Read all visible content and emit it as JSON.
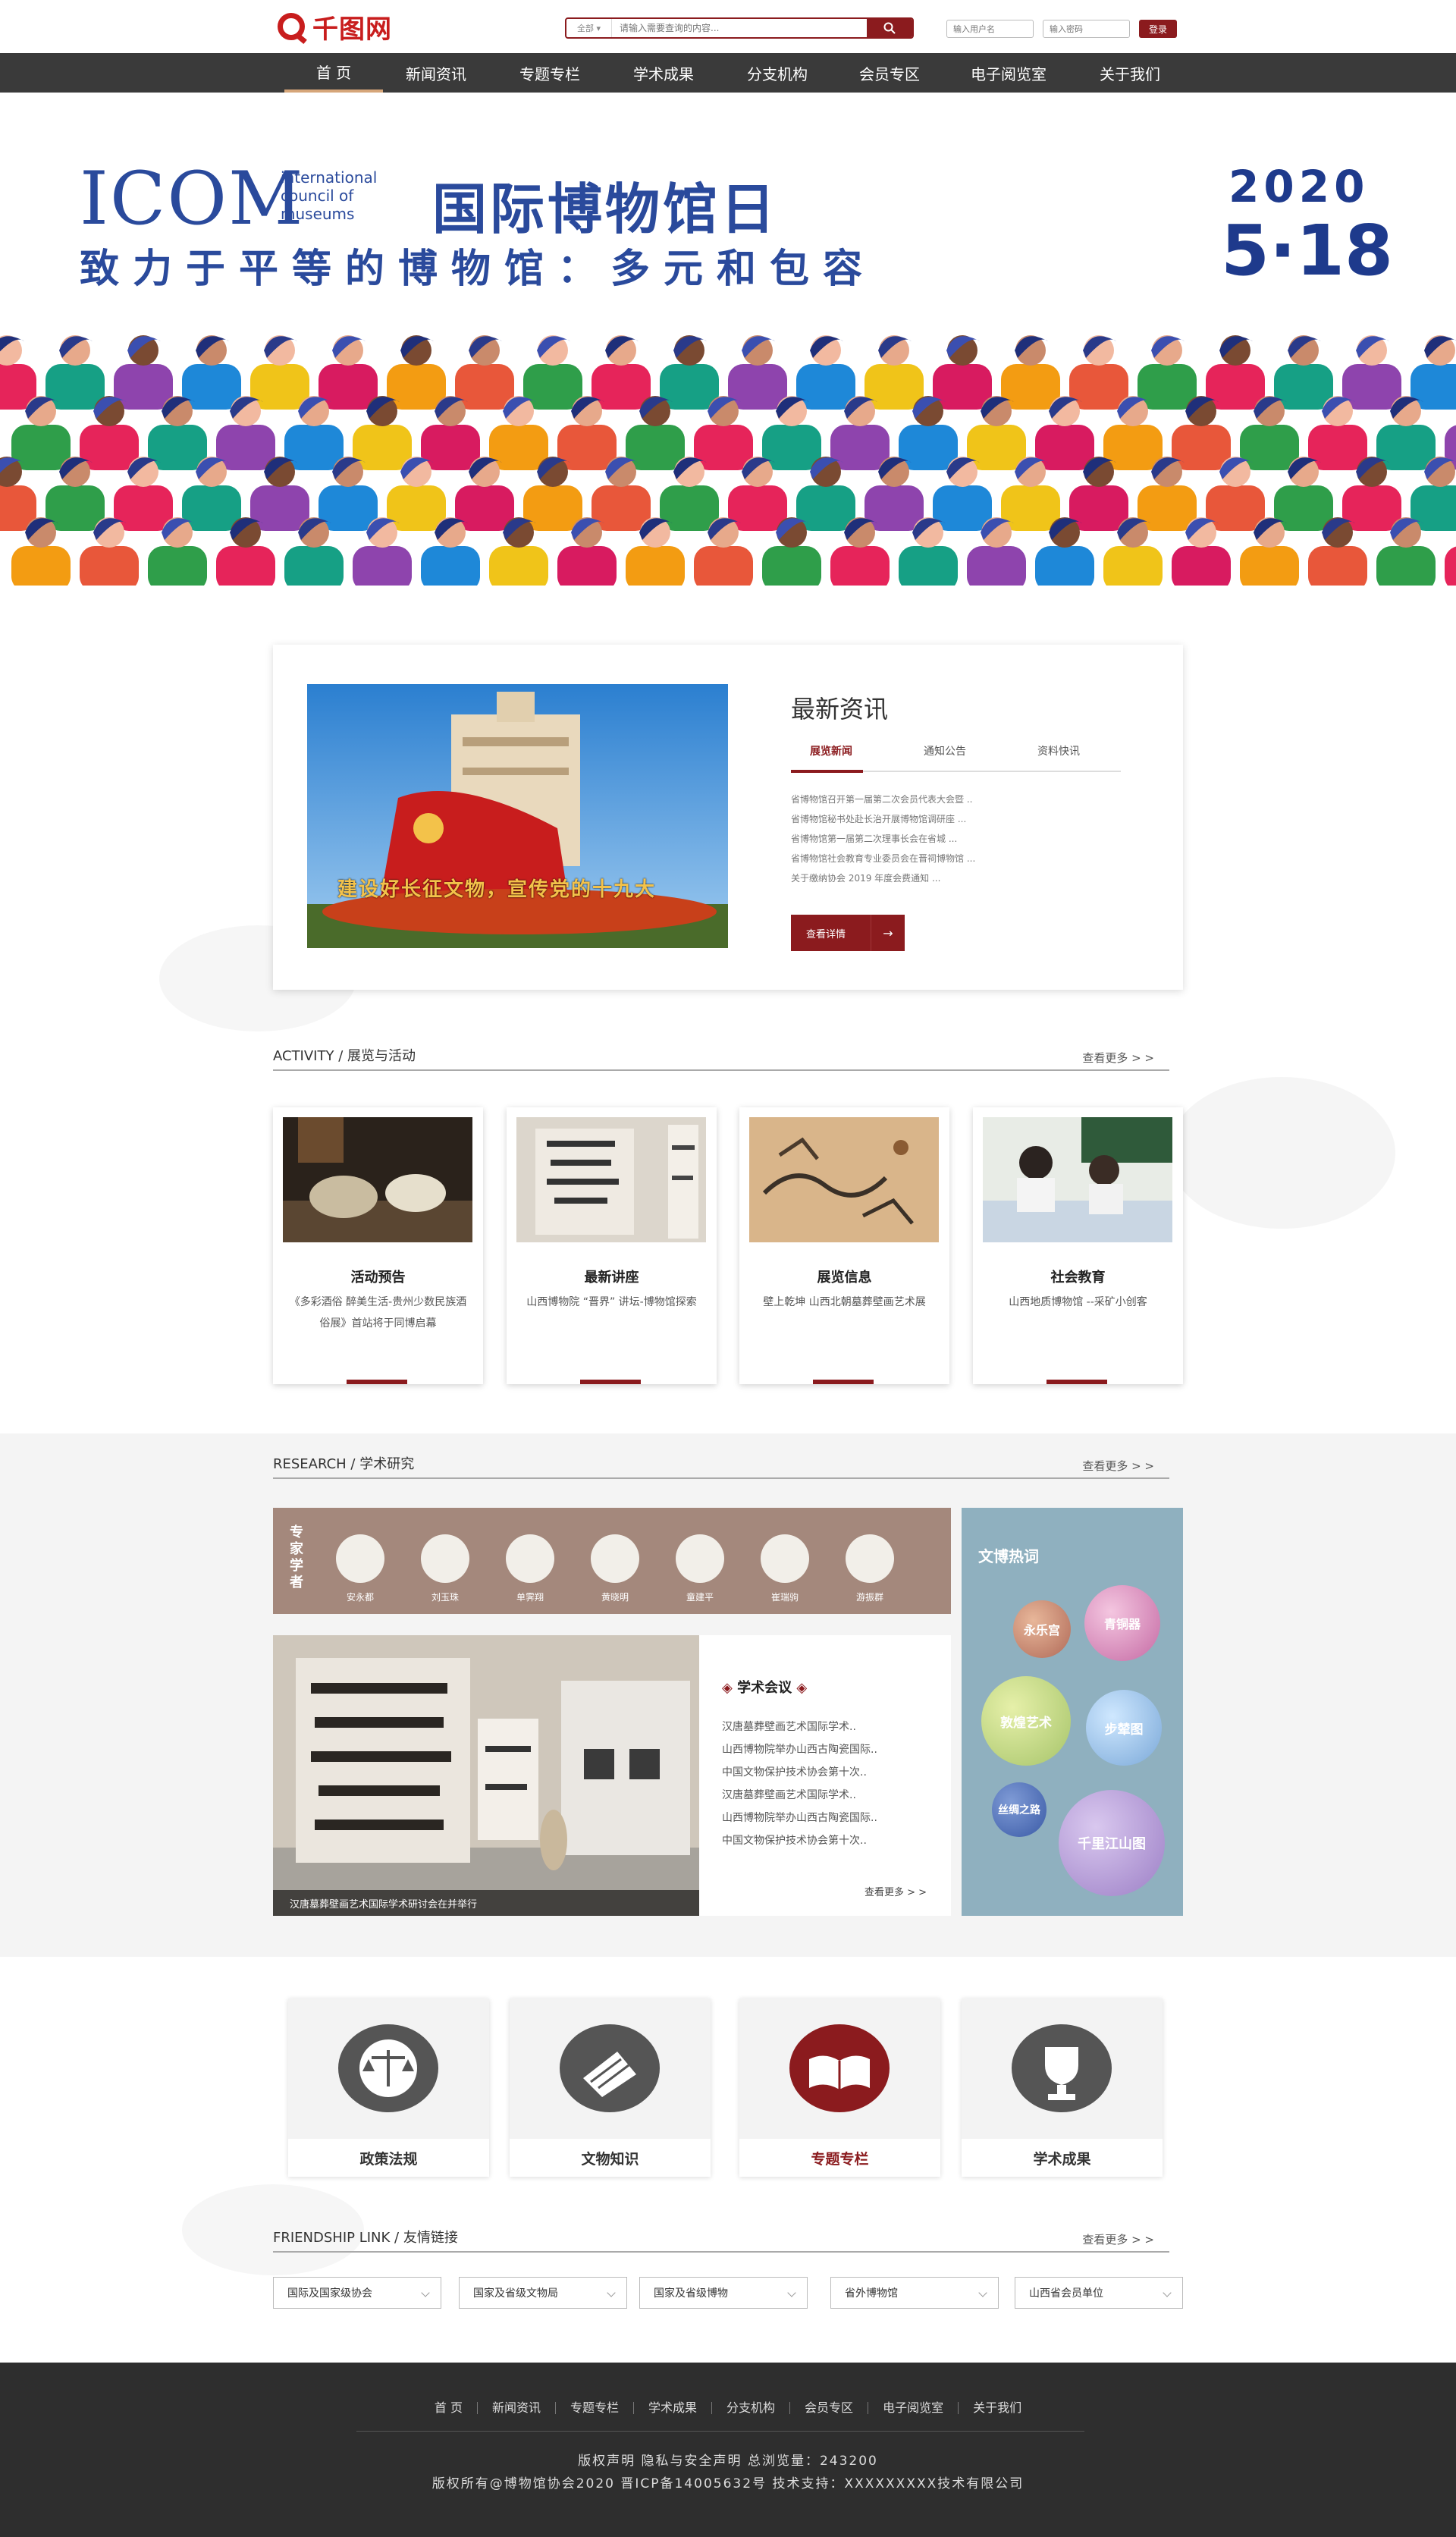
{
  "header": {
    "logo_text": "千图网",
    "search_scope": "全部",
    "search_placeholder": "请输入需要查询的内容...",
    "username_placeholder": "输入用户名",
    "password_placeholder": "输入密码",
    "login_label": "登录"
  },
  "nav": [
    "首 页",
    "新闻资讯",
    "专题专栏",
    "学术成果",
    "分支机构",
    "会员专区",
    "电子阅览室",
    "关于我们"
  ],
  "banner": {
    "icom": "ICOM",
    "icom_sub": "international council of museums",
    "title": "国际博物馆日",
    "subtitle": "致力于平等的博物馆：多元和包容",
    "year": "2020",
    "date": "5·18"
  },
  "news": {
    "title": "最新资讯",
    "tabs": [
      "展览新闻",
      "通知公告",
      "资料快讯"
    ],
    "items": [
      "省博物馆召开第一届第二次会员代表大会暨 ..",
      "省博物馆秘书处赴长治开展博物馆调研座 ...",
      "省博物馆第一届第二次理事长会在省城 ...",
      "省博物馆社会教育专业委员会在晋祠博物馆 ...",
      "关于缴纳协会 2019 年度会费通知 ..."
    ],
    "more_label": "查看详情",
    "more_arrow": "→",
    "image_text": "建设好长征文物，宣传党的十九大"
  },
  "activity": {
    "title": "ACTIVITY / 展览与活动",
    "more": "查看更多 > >",
    "cards": [
      {
        "title": "活动预告",
        "desc": "《多彩酒俗 醉美生活-贵州少数民族酒俗展》首站将于同博启幕"
      },
      {
        "title": "最新讲座",
        "desc": "山西博物院 “晋界” 讲坛-博物馆探索"
      },
      {
        "title": "展览信息",
        "desc": "壁上乾坤 山西北朝墓葬壁画艺术展"
      },
      {
        "title": "社会教育",
        "desc": "山西地质博物馆 --采矿小创客"
      }
    ]
  },
  "research": {
    "title": "RESEARCH / 学术研究",
    "more": "查看更多 > >",
    "experts_label": "专家学者",
    "experts": [
      "安永都",
      "刘玉珠",
      "单霁翔",
      "黄晓明",
      "童建平",
      "崔瑞驹",
      "游振群"
    ],
    "image_caption": "汉唐墓葬壁画艺术国际学术研讨会在并举行",
    "conf_title": "学术会议",
    "conf_items": [
      "汉唐墓葬壁画艺术国际学术..",
      "山西博物院举办山西古陶瓷国际..",
      "中国文物保护技术协会第十次..",
      "汉唐墓葬壁画艺术国际学术..",
      "山西博物院举办山西古陶瓷国际..",
      "中国文物保护技术协会第十次.."
    ],
    "conf_more": "查看更多 > >",
    "hot_title": "文博热词",
    "hot_words": [
      "永乐宫",
      "青铜器",
      "敦煌艺术",
      "步辇图",
      "丝绸之路",
      "千里江山图"
    ]
  },
  "quicklinks": [
    "政策法规",
    "文物知识",
    "专题专栏",
    "学术成果"
  ],
  "friendship": {
    "title": "FRIENDSHIP LINK / 友情链接",
    "more": "查看更多 > >",
    "selects": [
      "国际及国家级协会",
      "国家及省级文物局",
      "国家及省级博物",
      "省外博物馆",
      "山西省会员单位"
    ]
  },
  "footer": {
    "nav": [
      "首 页",
      "新闻资讯",
      "专题专栏",
      "学术成果",
      "分支机构",
      "会员专区",
      "电子阅览室",
      "关于我们"
    ],
    "line1": "版权声明  隐私与安全声明  总浏览量：243200",
    "line2": "版权所有@博物馆协会2020    晋ICP备14005632号    技术支持：XXXXXXXXX技术有限公司"
  },
  "colors": {
    "accent": "#8b1b1e",
    "nav_bg": "#3a3a3a",
    "banner_blue": "#2a4a9c",
    "footer_bg": "#2e2e2e",
    "hot_bg": "#8fb0bf",
    "experts_bg": "#a4887c"
  }
}
